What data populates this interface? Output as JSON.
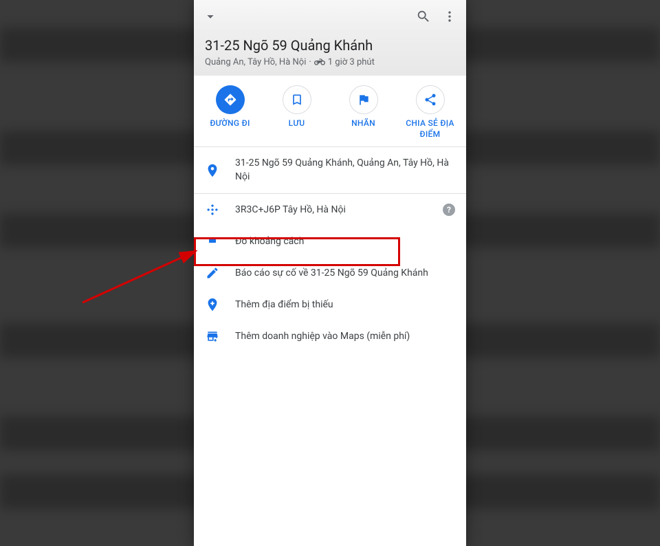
{
  "topbar": {},
  "header": {
    "title": "31-25 Ngõ 59 Quảng Khánh",
    "subtitle_location": "Quảng An, Tây Hồ, Hà Nội",
    "subtitle_sep": " · ",
    "subtitle_eta": "1 giờ 3 phút"
  },
  "actions": {
    "directions": "ĐƯỜNG ĐI",
    "save": "LƯU",
    "label": "NHÃN",
    "share": "CHIA SẺ ĐỊA ĐIỂM"
  },
  "rows": {
    "address": "31-25 Ngõ 59 Quảng Khánh, Quảng An, Tây Hồ, Hà Nội",
    "pluscode": "3R3C+J6P Tây Hồ, Hà Nội",
    "measure": "Đo khoảng cách",
    "report": "Báo cáo sự cố về 31-25 Ngõ 59 Quảng Khánh",
    "missing": "Thêm địa điểm bị thiếu",
    "business": "Thêm doanh nghiệp vào Maps (miễn phí)"
  },
  "colors": {
    "accent": "#1a73e8",
    "danger": "#d40000"
  }
}
